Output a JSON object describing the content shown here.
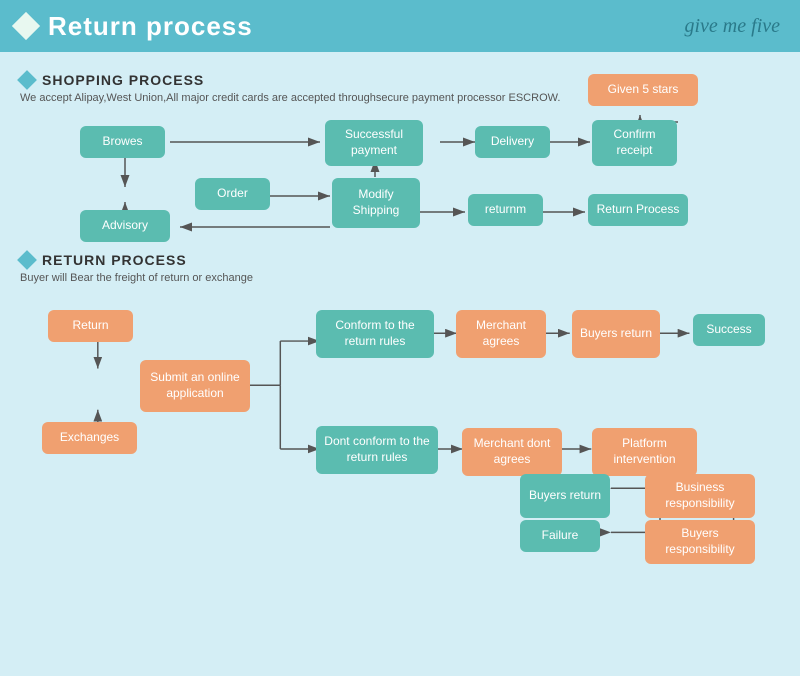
{
  "header": {
    "title": "Return process",
    "logo": "give me five"
  },
  "shopping": {
    "title": "SHOPPING PROCESS",
    "subtitle": "We accept Alipay,West Union,All major credit cards are accepted throughsecure payment processor ESCROW.",
    "boxes": {
      "browes": "Browes",
      "order": "Order",
      "advisory": "Advisory",
      "modify_shipping": "Modify\nShipping",
      "successful_payment": "Successful\npayment",
      "delivery": "Delivery",
      "confirm_receipt": "Confirm\nreceipt",
      "given_5_stars": "Given 5 stars",
      "returnm": "returnm",
      "return_process": "Return Process"
    }
  },
  "return": {
    "title": "RETURN PROCESS",
    "subtitle": "Buyer will Bear the freight of return or exchange",
    "boxes": {
      "return": "Return",
      "exchanges": "Exchanges",
      "submit_online": "Submit an online\napplication",
      "conform_rules": "Conform to the\nreturn rules",
      "dont_conform_rules": "Dont conform to the\nreturn rules",
      "merchant_agrees": "Merchant\nagrees",
      "merchant_dont": "Merchant\ndont agrees",
      "buyers_return1": "Buyers\nreturn",
      "buyers_return2": "Buyers\nreturn",
      "platform_intervention": "Platform\nintervention",
      "success": "Success",
      "business_responsibility": "Business\nresponsibility",
      "buyers_responsibility": "Buyers\nresponsibility",
      "failure": "Failure"
    }
  }
}
